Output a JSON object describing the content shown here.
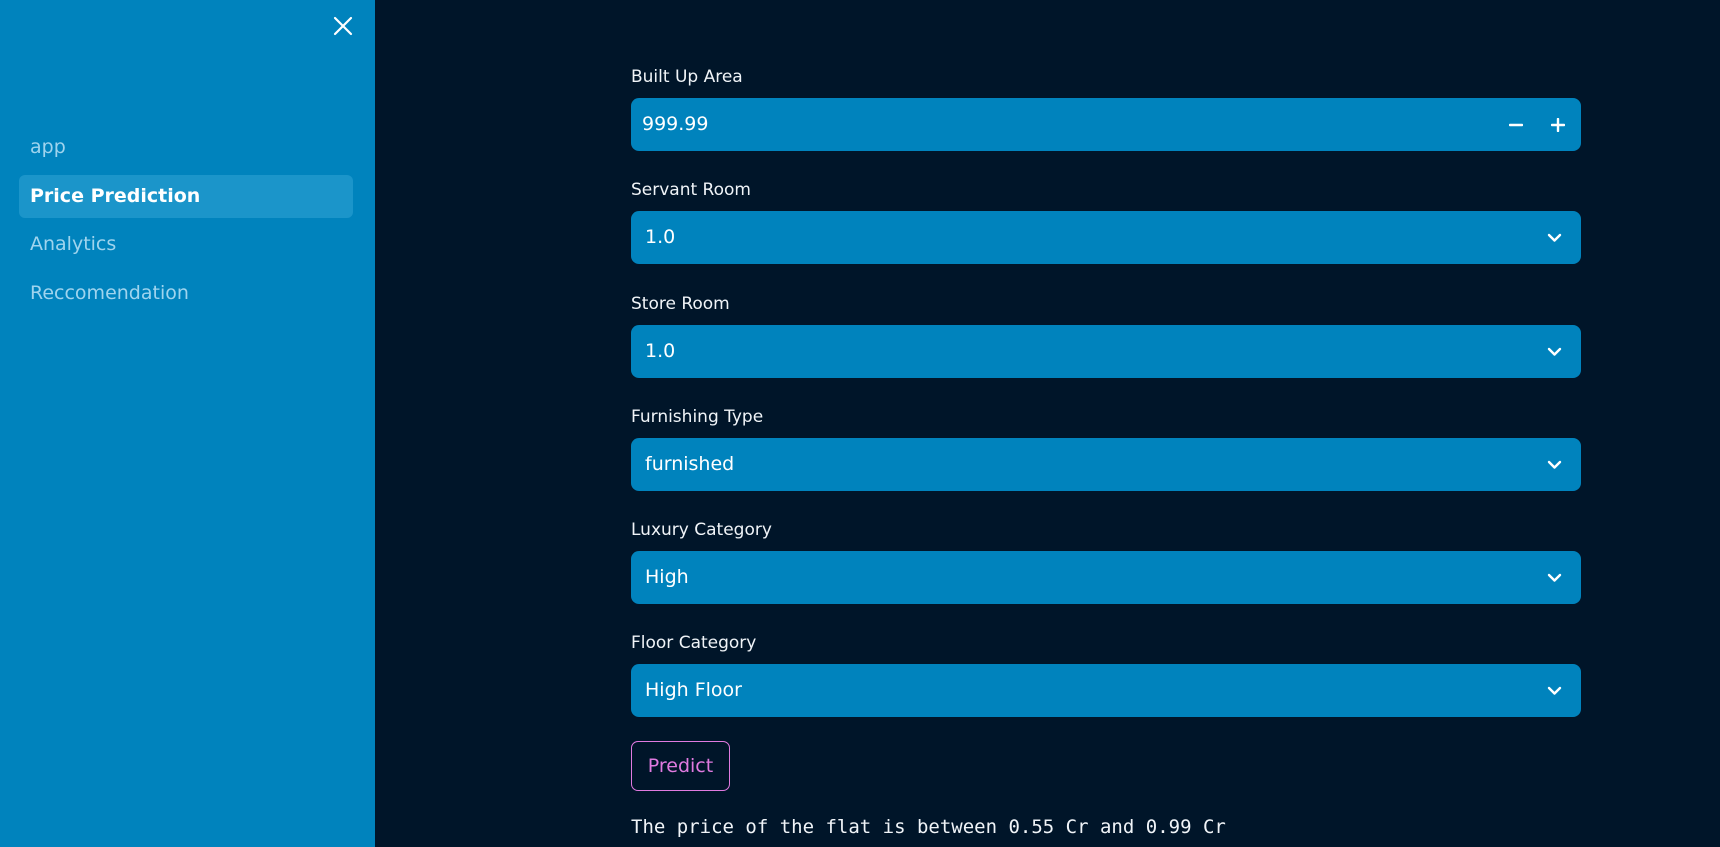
{
  "sidebar": {
    "items": [
      {
        "label": "app",
        "active": false
      },
      {
        "label": "Price Prediction",
        "active": true
      },
      {
        "label": "Analytics",
        "active": false
      },
      {
        "label": "Reccomendation",
        "active": false
      }
    ]
  },
  "form": {
    "built_up_area": {
      "label": "Built Up Area",
      "value": "999.99"
    },
    "servant_room": {
      "label": "Servant Room",
      "value": "1.0"
    },
    "store_room": {
      "label": "Store Room",
      "value": "1.0"
    },
    "furnishing_type": {
      "label": "Furnishing Type",
      "value": "furnished"
    },
    "luxury_category": {
      "label": "Luxury Category",
      "value": "High"
    },
    "floor_category": {
      "label": "Floor Category",
      "value": "High Floor"
    }
  },
  "predict_label": "Predict",
  "result_text": "The price of the flat is between 0.55 Cr and 0.99 Cr",
  "colors": {
    "sidebar_bg": "#0083bd",
    "main_bg": "#001529",
    "accent": "#e07ae0"
  }
}
